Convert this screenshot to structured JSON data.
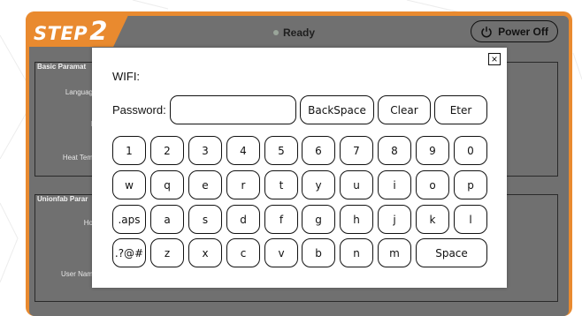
{
  "header": {
    "step_word": "STEP",
    "step_number": "2",
    "status": "Ready",
    "power_label": "Power Off"
  },
  "background": {
    "basic_group": "Basic Paramat",
    "basic_fields": [
      "Languag",
      "I",
      "Heat Tem"
    ],
    "union_group": "Unionfab Parar",
    "union_fields": [
      "Ho",
      "User Nam"
    ]
  },
  "dialog": {
    "close_label": "×",
    "wifi_label": "WIFI:",
    "password_label": "Password:",
    "password_value": "",
    "actions": [
      "BackSpace",
      "Clear",
      "Eter"
    ],
    "keys": {
      "row1": [
        "1",
        "2",
        "3",
        "4",
        "5",
        "6",
        "7",
        "8",
        "9",
        "0"
      ],
      "row2": [
        "w",
        "q",
        "e",
        "r",
        "t",
        "y",
        "u",
        "i",
        "o",
        "p"
      ],
      "row3": [
        ".aps",
        "a",
        "s",
        "d",
        "f",
        "g",
        "h",
        "j",
        "k",
        "l"
      ],
      "row4": [
        ".?@#",
        "z",
        "x",
        "c",
        "v",
        "b",
        "n",
        "m",
        "Space"
      ]
    }
  },
  "colors": {
    "accent": "#e98a2f",
    "panel": "#707070",
    "status_dot": "#9aa59a"
  }
}
